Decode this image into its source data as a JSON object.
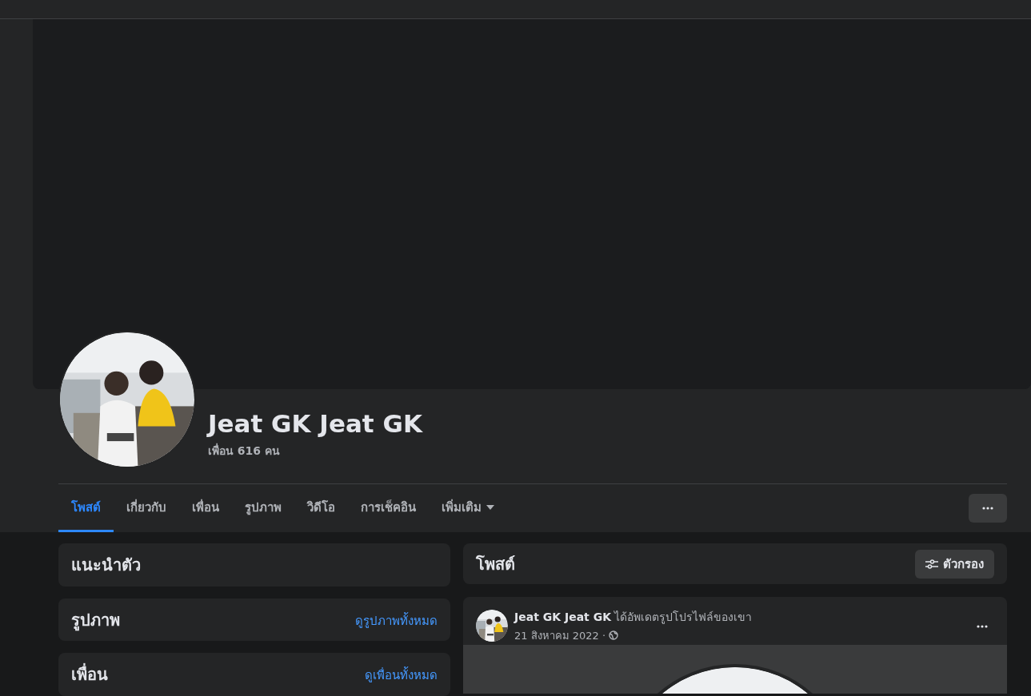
{
  "profile": {
    "name": "Jeat GK Jeat GK",
    "friends_count": "เพื่อน 616 คน"
  },
  "tabs": [
    {
      "label": "โพสต์",
      "selected": true,
      "kind": "link"
    },
    {
      "label": "เกี่ยวกับ",
      "selected": false,
      "kind": "link"
    },
    {
      "label": "เพื่อน",
      "selected": false,
      "kind": "link"
    },
    {
      "label": "รูปภาพ",
      "selected": false,
      "kind": "link"
    },
    {
      "label": "วิดีโอ",
      "selected": false,
      "kind": "link"
    },
    {
      "label": "การเช็คอิน",
      "selected": false,
      "kind": "link"
    },
    {
      "label": "เพิ่มเติม",
      "selected": false,
      "kind": "dropdown"
    }
  ],
  "sidebar": {
    "cards": [
      {
        "title": "แนะนำตัว"
      },
      {
        "title": "รูปภาพ",
        "link": "ดูรูปภาพทั้งหมด"
      },
      {
        "title": "เพื่อน",
        "link": "ดูเพื่อนทั้งหมด"
      }
    ]
  },
  "posts": {
    "title": "โพสต์",
    "filter_button": "ตัวกรอง",
    "items": [
      {
        "author": "Jeat GK Jeat GK",
        "action": "ได้อัพเดตรูปโปรไฟล์ของเขา",
        "date": "21 สิงหาคม 2022 ·",
        "public": true
      }
    ]
  }
}
